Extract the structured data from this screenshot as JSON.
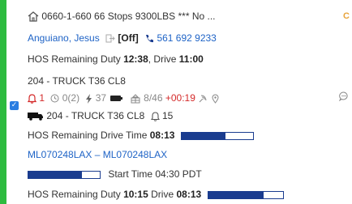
{
  "trip": {
    "title": "0660-1-660 66 Stops 9300LBS *** No ...",
    "flag": "C"
  },
  "driver": {
    "name": "Anguiano, Jesus",
    "status": "[Off]",
    "phone": "561 692 9233"
  },
  "hos1": {
    "prefix": "HOS Remaining Duty",
    "duty": "12:38",
    "drive_prefix": ", Drive",
    "drive": "11:00"
  },
  "truck": "204 - TRUCK T36 CL8",
  "stats": {
    "alerts": "1",
    "time": "0(2)",
    "charge": "37",
    "count": "8/46",
    "offset": "+00:19"
  },
  "truck_line": {
    "label": "204 - TRUCK T36 CL8",
    "alerts": "15"
  },
  "hos_drive": {
    "label": "HOS Remaining Drive Time",
    "value": "08:13",
    "fraction": 0.62
  },
  "route": "ML070248LAX – ML070248LAX",
  "start": {
    "label": "Start Time 04:30 PDT",
    "fraction": 0.75
  },
  "hos2": {
    "prefix": "HOS Remaining Duty",
    "duty": "10:15",
    "drive_prefix": "Drive",
    "drive": "08:13",
    "fraction": 0.74
  },
  "colors": {
    "accent": "#2dbb3f",
    "link": "#1e63c6",
    "alert": "#d42a2a",
    "bar": "#1a3c8f"
  }
}
